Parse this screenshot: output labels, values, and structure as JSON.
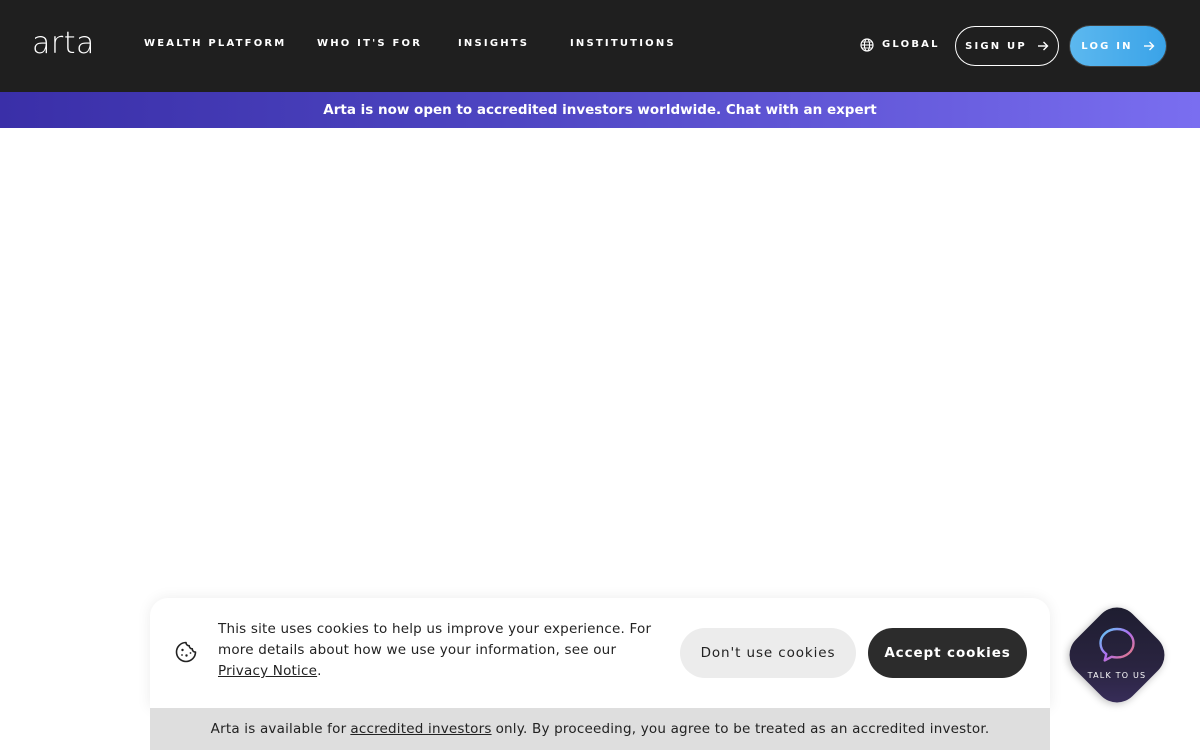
{
  "header": {
    "logo": "arta",
    "nav": [
      {
        "label": "WEALTH PLATFORM"
      },
      {
        "label": "WHO IT'S FOR"
      },
      {
        "label": "INSIGHTS"
      },
      {
        "label": "INSTITUTIONS"
      }
    ],
    "region_label": "GLOBAL",
    "signup_label": "SIGN UP",
    "login_label": "LOG IN"
  },
  "banner": {
    "text": "Arta is now open to accredited investors worldwide. Chat with an expert"
  },
  "cookie": {
    "text_before_link": "This site uses cookies to help us improve your experience. For more details about how we use your information, see our ",
    "privacy_link": "Privacy Notice",
    "text_after_link": ".",
    "decline_label": "Don't use cookies",
    "accept_label": "Accept cookies"
  },
  "accredited_notice": {
    "before": "Arta is available for",
    "link": "accredited investors",
    "after": "only. By proceeding, you agree to be treated as an accredited investor."
  },
  "chat_widget": {
    "label": "TALK TO US"
  },
  "colors": {
    "header_bg": "#1f1f1f",
    "banner_start": "#3a2fa8",
    "banner_end": "#7a6ef0",
    "login_bg": "#4aaeea",
    "accept_bg": "#2c2c2c",
    "decline_bg": "#ececec",
    "notice_bg": "#dedede"
  }
}
